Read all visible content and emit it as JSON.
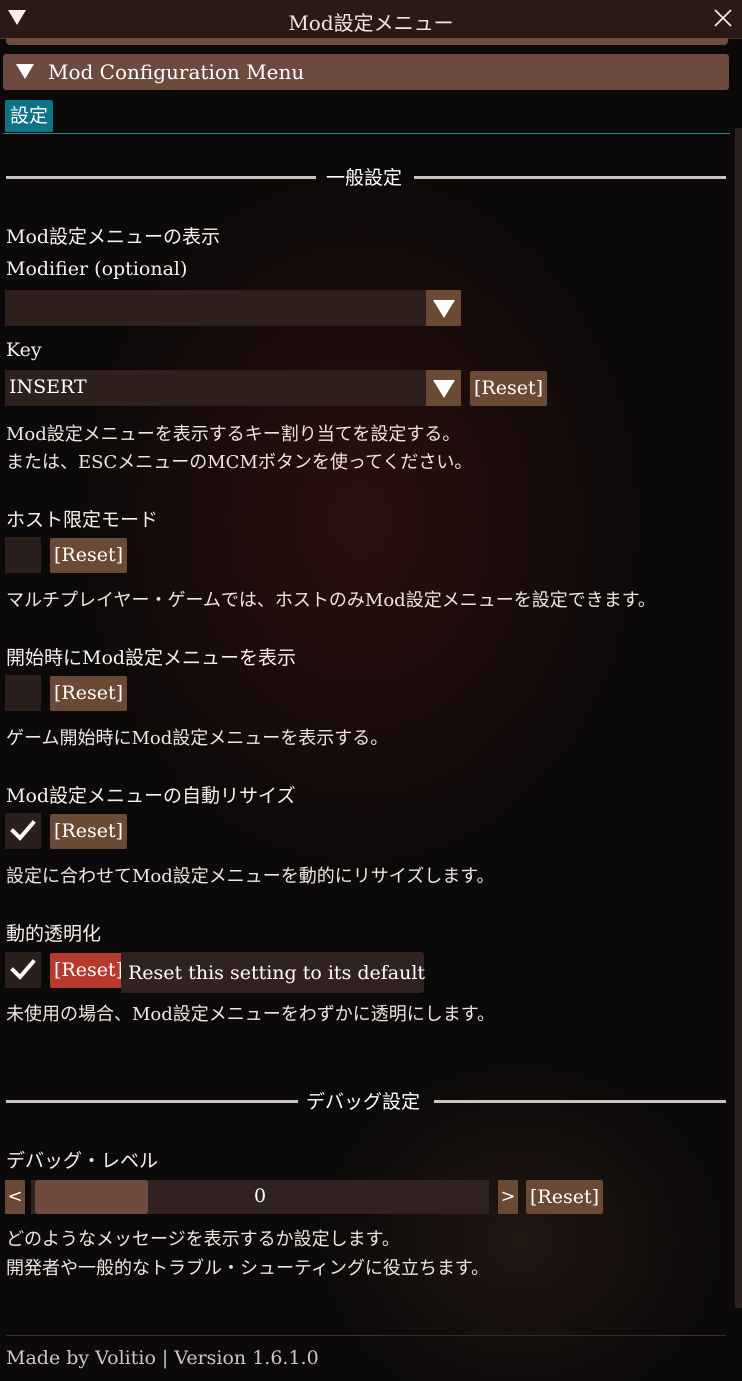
{
  "window": {
    "title": "Mod設定メニュー"
  },
  "header": {
    "label": "Mod Configuration Menu"
  },
  "tabs": [
    {
      "label": "設定"
    }
  ],
  "sections": {
    "general": {
      "title": "一般設定"
    },
    "debug": {
      "title": "デバッグ設定"
    }
  },
  "settings": {
    "menu_key": {
      "title": "Mod設定メニューの表示",
      "modifier_label": "Modifier (optional)",
      "modifier_value": "",
      "key_label": "Key",
      "key_value": "INSERT",
      "reset_label": "[Reset]",
      "desc_line1": "Mod設定メニューを表示するキー割り当てを設定する。",
      "desc_line2": "または、ESCメニューのMCMボタンを使ってください。"
    },
    "host_only": {
      "title": "ホスト限定モード",
      "checked": false,
      "reset_label": "[Reset]",
      "desc": "マルチプレイヤー・ゲームでは、ホストのみMod設定メニューを設定できます。"
    },
    "show_on_start": {
      "title": "開始時にMod設定メニューを表示",
      "checked": false,
      "reset_label": "[Reset]",
      "desc": "ゲーム開始時にMod設定メニューを表示する。"
    },
    "auto_resize": {
      "title": "Mod設定メニューの自動リサイズ",
      "checked": true,
      "reset_label": "[Reset]",
      "desc": "設定に合わせてMod設定メニューを動的にリサイズします。"
    },
    "dynamic_transparency": {
      "title": "動的透明化",
      "checked": true,
      "reset_label": "[Reset]",
      "tooltip": "Reset this setting to its default",
      "desc": "未使用の場合、Mod設定メニューをわずかに透明にします。"
    },
    "debug_level": {
      "title": "デバッグ・レベル",
      "dec_label": "<",
      "inc_label": ">",
      "value": "0",
      "reset_label": "[Reset]",
      "desc_line1": "どのようなメッセージを表示するか設定します。",
      "desc_line2": "開発者や一般的なトラブル・シューティングに役立ちます。"
    }
  },
  "footer": {
    "text": "Made by Volitio | Version 1.6.1.0"
  },
  "colors": {
    "accent_tab": "#0e7384",
    "button": "#6b4a35",
    "button_active": "#b83a2c",
    "header": "#6c4a3f"
  },
  "icons": [
    "collapse-triangle-icon",
    "close-icon",
    "dropdown-arrow-icon",
    "checkmark-icon"
  ]
}
